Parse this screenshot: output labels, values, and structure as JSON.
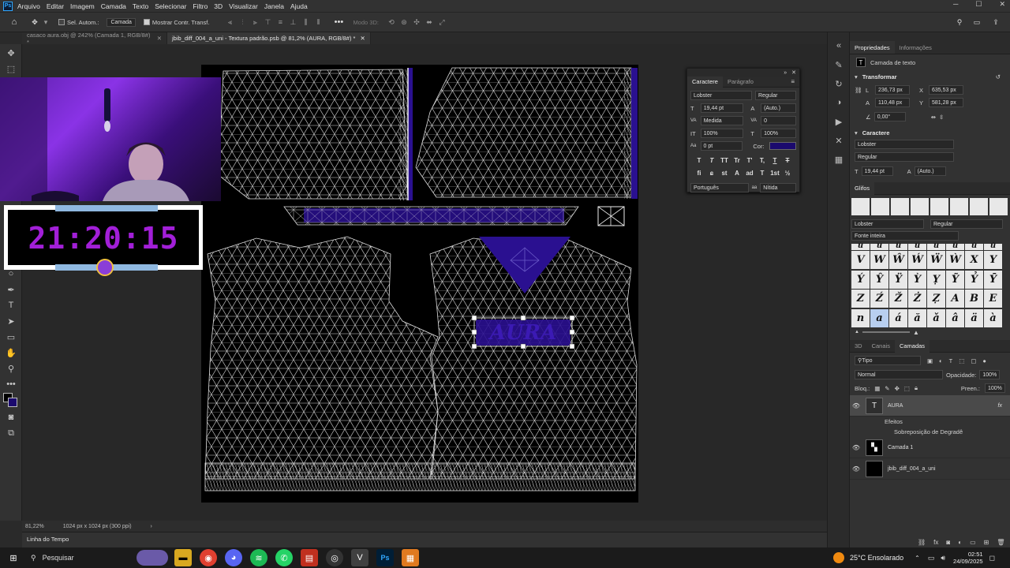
{
  "menubar": {
    "app_badge": "Ps",
    "items": [
      "Arquivo",
      "Editar",
      "Imagem",
      "Camada",
      "Texto",
      "Selecionar",
      "Filtro",
      "3D",
      "Visualizar",
      "Janela",
      "Ajuda"
    ]
  },
  "options": {
    "auto_select_label": "Sel. Autom.:",
    "auto_select_value": "Camada",
    "show_transform_label": "Mostrar Contr. Transf.",
    "mode_3d_label": "Modo 3D:"
  },
  "tabs": [
    {
      "label": "casaco aura.obj @ 242% (Camada 1, RGB/8#) *"
    },
    {
      "label": "jbib_diff_004_a_uni - Textura padrão.psb @ 81,2% (AURA, RGB/8#) *"
    }
  ],
  "status": {
    "zoom": "81,22%",
    "doc_size": "1024 px x 1024 px (300 ppi)"
  },
  "timeline": {
    "label": "Linha do Tempo"
  },
  "clock": {
    "time": "21:20:15"
  },
  "char_float": {
    "tabs": [
      "Caractere",
      "Parágrafo"
    ],
    "font": "Lobster",
    "style": "Regular",
    "size": "19,44 pt",
    "leading": "(Auto.)",
    "kerning": "Medida",
    "tracking": "0",
    "vscale": "100%",
    "hscale": "100%",
    "baseline": "0 pt",
    "color_label": "Cor:",
    "color": "#1b0a6e",
    "language": "Português",
    "aa_method": "Nítida",
    "format_buttons": [
      "T",
      "T",
      "TT",
      "Tr",
      "T'",
      "T,",
      "T",
      "T"
    ],
    "ot_buttons": [
      "fi",
      "ɕ",
      "st",
      "A",
      "ad",
      "T",
      "1st",
      "½"
    ]
  },
  "properties": {
    "tabs": [
      "Propriedades",
      "Informações"
    ],
    "layer_type": "Camada de texto",
    "transform_title": "Transformar",
    "w": "236,73 px",
    "h": "110,48 px",
    "x": "635,53 px",
    "y": "581,28 px",
    "angle": "0,00°",
    "w_label": "L",
    "h_label": "A",
    "x_label": "X",
    "y_label": "Y",
    "char_title": "Caractere",
    "font": "Lobster",
    "style": "Regular",
    "size": "19,44 pt",
    "leading": "(Auto.)"
  },
  "glyphs": {
    "title": "Glifos",
    "font": "Lobster",
    "style": "Regular",
    "filter": "Fonte inteira",
    "rows": [
      [
        "ú",
        "ū",
        "û",
        "ũ",
        "ü",
        "ű",
        "ǔ",
        "ŭ"
      ],
      [
        "V",
        "W",
        "Ŵ",
        "Ẃ",
        "Ẅ",
        "Ẁ",
        "X",
        "Y"
      ],
      [
        "Ý",
        "Ŷ",
        "Ÿ",
        "Ỳ",
        "Ỵ",
        "Ỹ",
        "Ỷ",
        "Ȳ"
      ],
      [
        "Z",
        "Ź",
        "Ž",
        "Ż",
        "Ẓ",
        "A",
        "B",
        "E"
      ],
      [
        "n",
        "a",
        "á",
        "ă",
        "ǎ",
        "â",
        "ä",
        "à"
      ]
    ]
  },
  "layers_panel": {
    "tabs": [
      "3D",
      "Canais",
      "Camadas"
    ],
    "filter": "Tipo",
    "blend_mode": "Normal",
    "opacity_label": "Opacidade:",
    "opacity": "100%",
    "lock_label": "Bloq.:",
    "fill_label": "Preen.:",
    "fill": "100%",
    "layers": [
      {
        "name": "AURA",
        "type": "text",
        "fx": "fx"
      },
      {
        "name": "Efeitos",
        "type": "effects"
      },
      {
        "name": "Sobreposição de Degradê",
        "type": "effect"
      },
      {
        "name": "Camada 1",
        "type": "image"
      },
      {
        "name": "jbib_diff_004_a_uni",
        "type": "image"
      }
    ]
  },
  "taskbar": {
    "search_placeholder": "Pesquisar",
    "weather": "25°C  Ensolarado",
    "time": "02:51",
    "date": "24/09/2025"
  },
  "colors": {
    "accent_purple": "#2a1090",
    "clock_text": "#a21fd8",
    "clock_band": "#8fb8e0"
  }
}
